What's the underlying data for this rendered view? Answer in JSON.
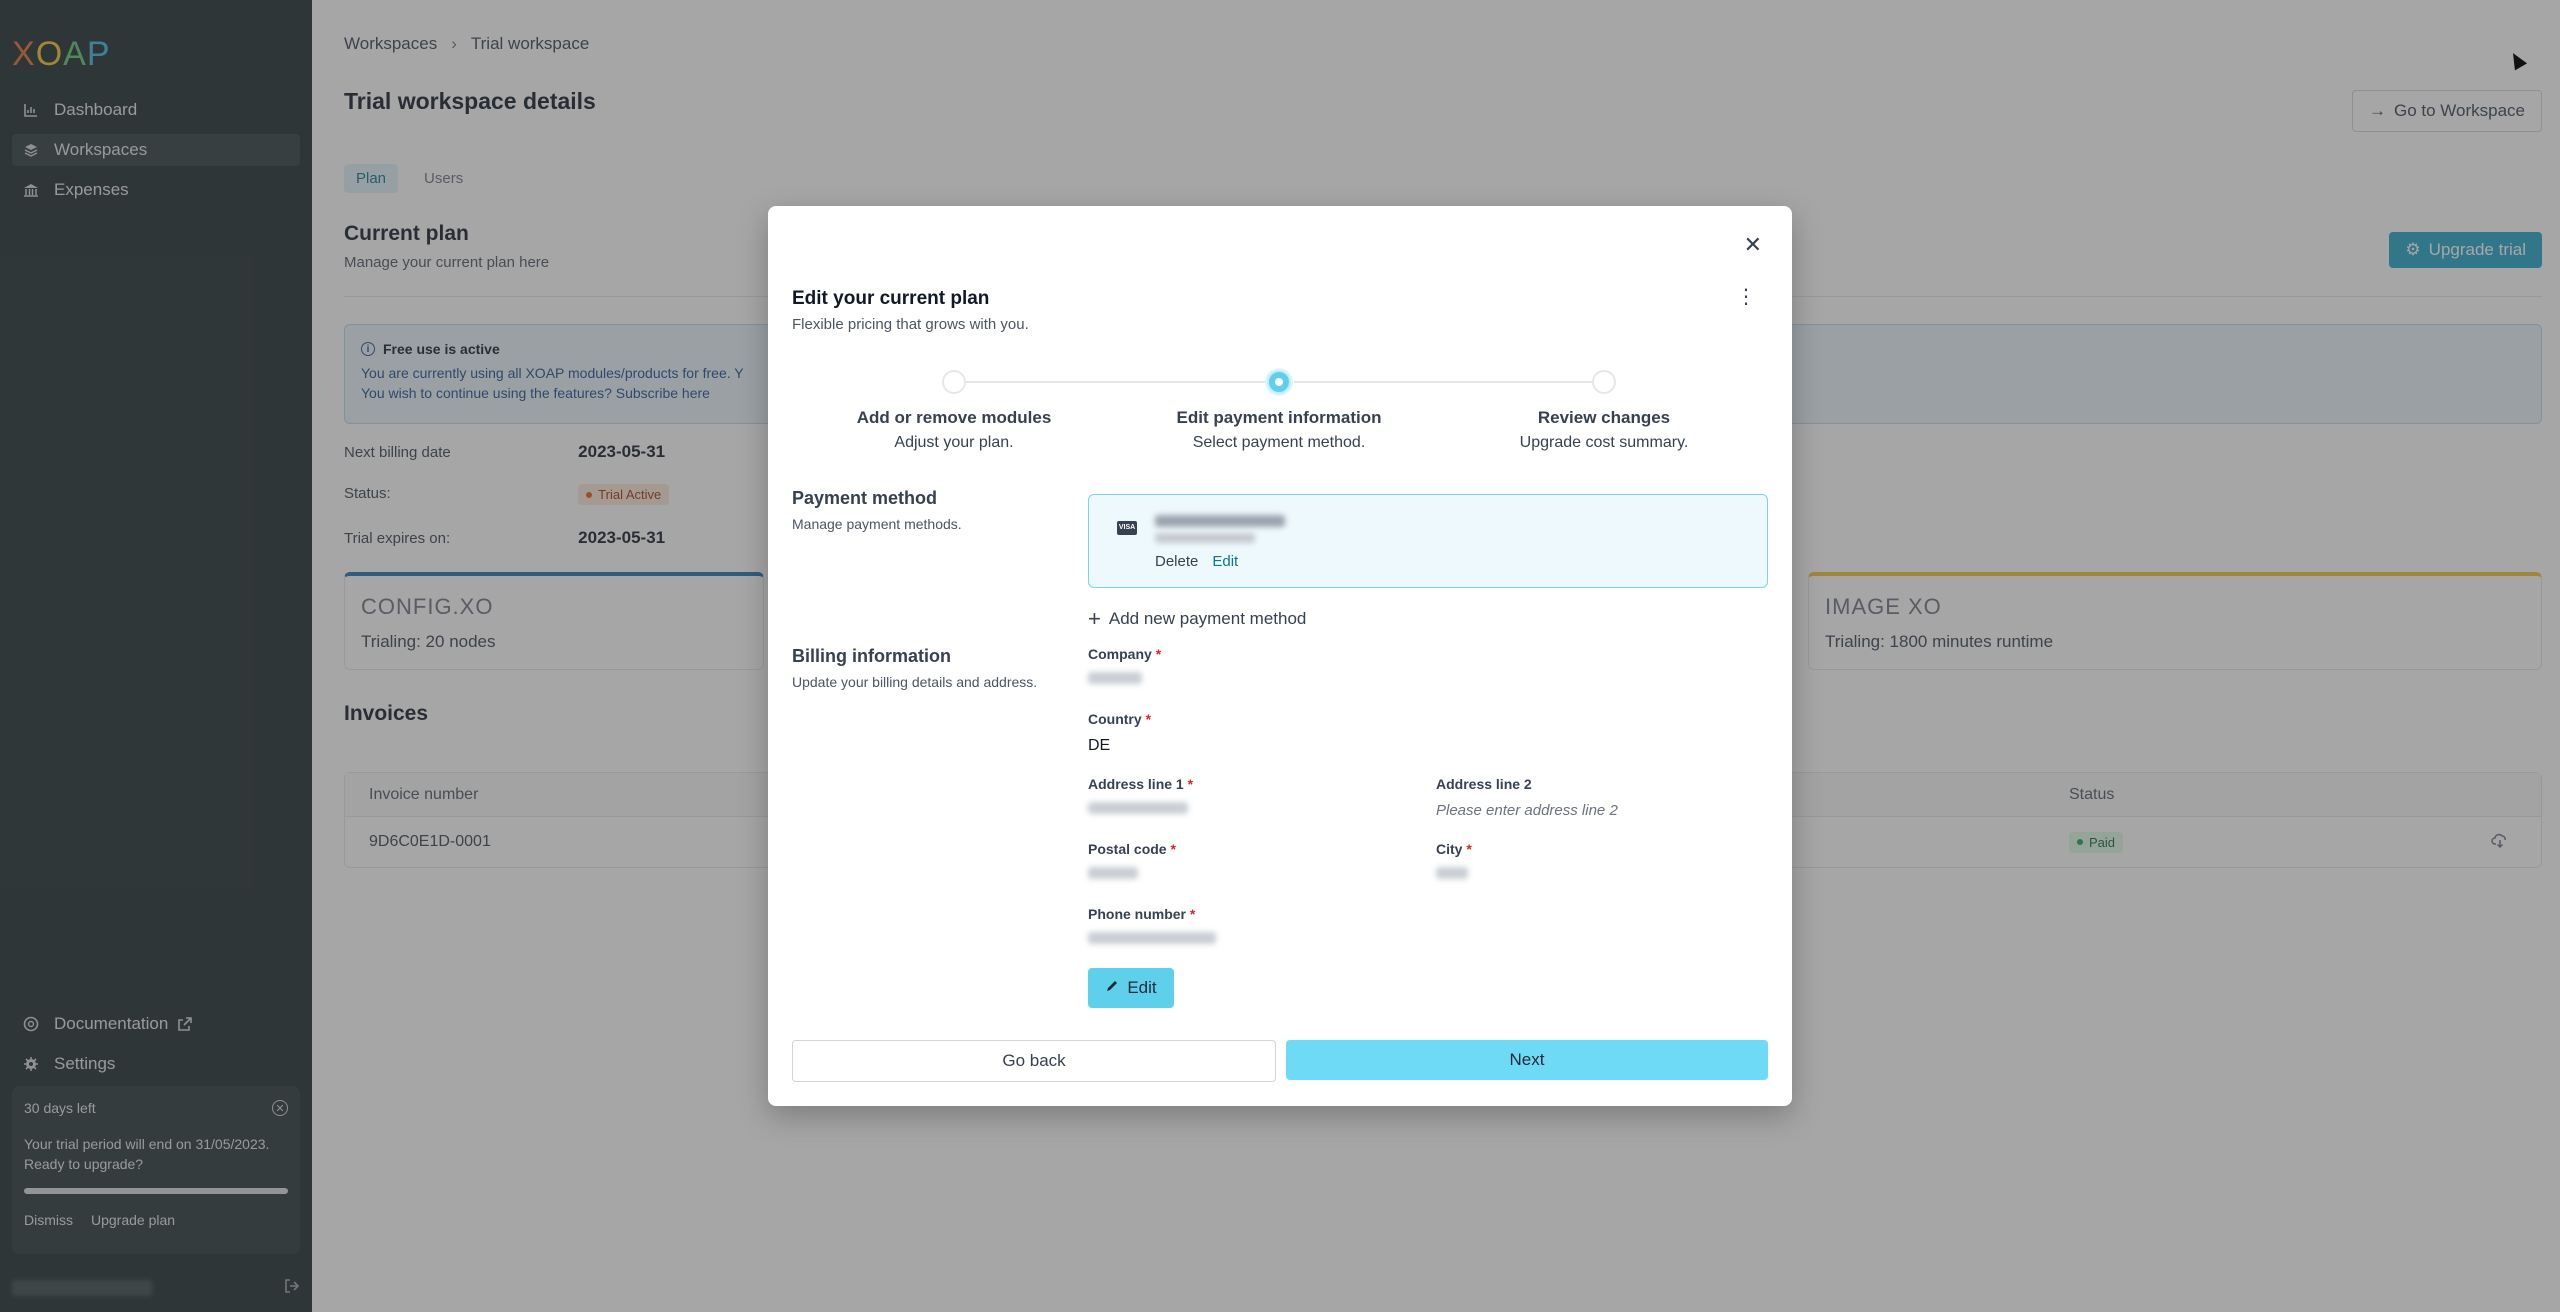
{
  "sidebar": {
    "logo": "XOAP",
    "nav": [
      {
        "label": "Dashboard",
        "icon": "chart-icon"
      },
      {
        "label": "Workspaces",
        "icon": "layers-icon"
      },
      {
        "label": "Expenses",
        "icon": "bank-icon"
      }
    ],
    "bottom": [
      {
        "label": "Documentation",
        "icon": "help-icon"
      },
      {
        "label": "Settings",
        "icon": "gear-icon"
      }
    ],
    "trial": {
      "title": "30 days left",
      "message": "Your trial period will end on 31/05/2023. Ready to upgrade?",
      "progress": 0.99,
      "dismiss": "Dismiss",
      "upgrade": "Upgrade plan"
    }
  },
  "main": {
    "breadcrumb": [
      "Workspaces",
      "Trial workspace"
    ],
    "title": "Trial workspace details",
    "goto_label": "Go to Workspace",
    "tabs": [
      "Plan",
      "Users"
    ],
    "current_plan": {
      "title": "Current plan",
      "subtitle": "Manage your current plan here",
      "upgrade_label": "Upgrade trial"
    },
    "alert": {
      "title": "Free use is active",
      "line1": "You are currently using all XOAP modules/products for free. Y",
      "line2": "You wish to continue using the features? Subscribe here"
    },
    "details": {
      "billing_label": "Next billing date",
      "billing_value": "2023-05-31",
      "status_label": "Status:",
      "status_value": "Trial Active",
      "expires_label": "Trial expires on:",
      "expires_value": "2023-05-31"
    },
    "modules": [
      {
        "brand": "CONFIG.XO",
        "trialing": "Trialing: 20 nodes",
        "accent": "#1f6fb5"
      },
      {
        "brand": "IMAGE XO",
        "trialing": "Trialing: 1800 minutes runtime",
        "accent": "#f2c230"
      }
    ],
    "invoices": {
      "title": "Invoices",
      "columns": [
        "Invoice number",
        "Status"
      ],
      "rows": [
        {
          "number": "9D6C0E1D-0001",
          "status": "Paid"
        }
      ]
    }
  },
  "modal": {
    "title": "Edit your current plan",
    "subtitle": "Flexible pricing that grows with you.",
    "steps": [
      {
        "title": "Add or remove modules",
        "desc": "Adjust your plan."
      },
      {
        "title": "Edit payment information",
        "desc": "Select payment method."
      },
      {
        "title": "Review changes",
        "desc": "Upgrade cost summary."
      }
    ],
    "active_step": 2,
    "payment": {
      "label": "Payment method",
      "desc": "Manage payment methods.",
      "card_brand": "VISA",
      "delete_label": "Delete",
      "edit_label": "Edit",
      "add_label": "Add new payment method"
    },
    "billing": {
      "label": "Billing information",
      "desc": "Update your billing details and address.",
      "company_label": "Company",
      "country_label": "Country",
      "country_value": "DE",
      "address1_label": "Address line 1",
      "address2_label": "Address line 2",
      "address2_placeholder": "Please enter address line 2",
      "postal_label": "Postal code",
      "city_label": "City",
      "phone_label": "Phone number",
      "edit_label": "Edit"
    },
    "go_back": "Go back",
    "next": "Next"
  }
}
